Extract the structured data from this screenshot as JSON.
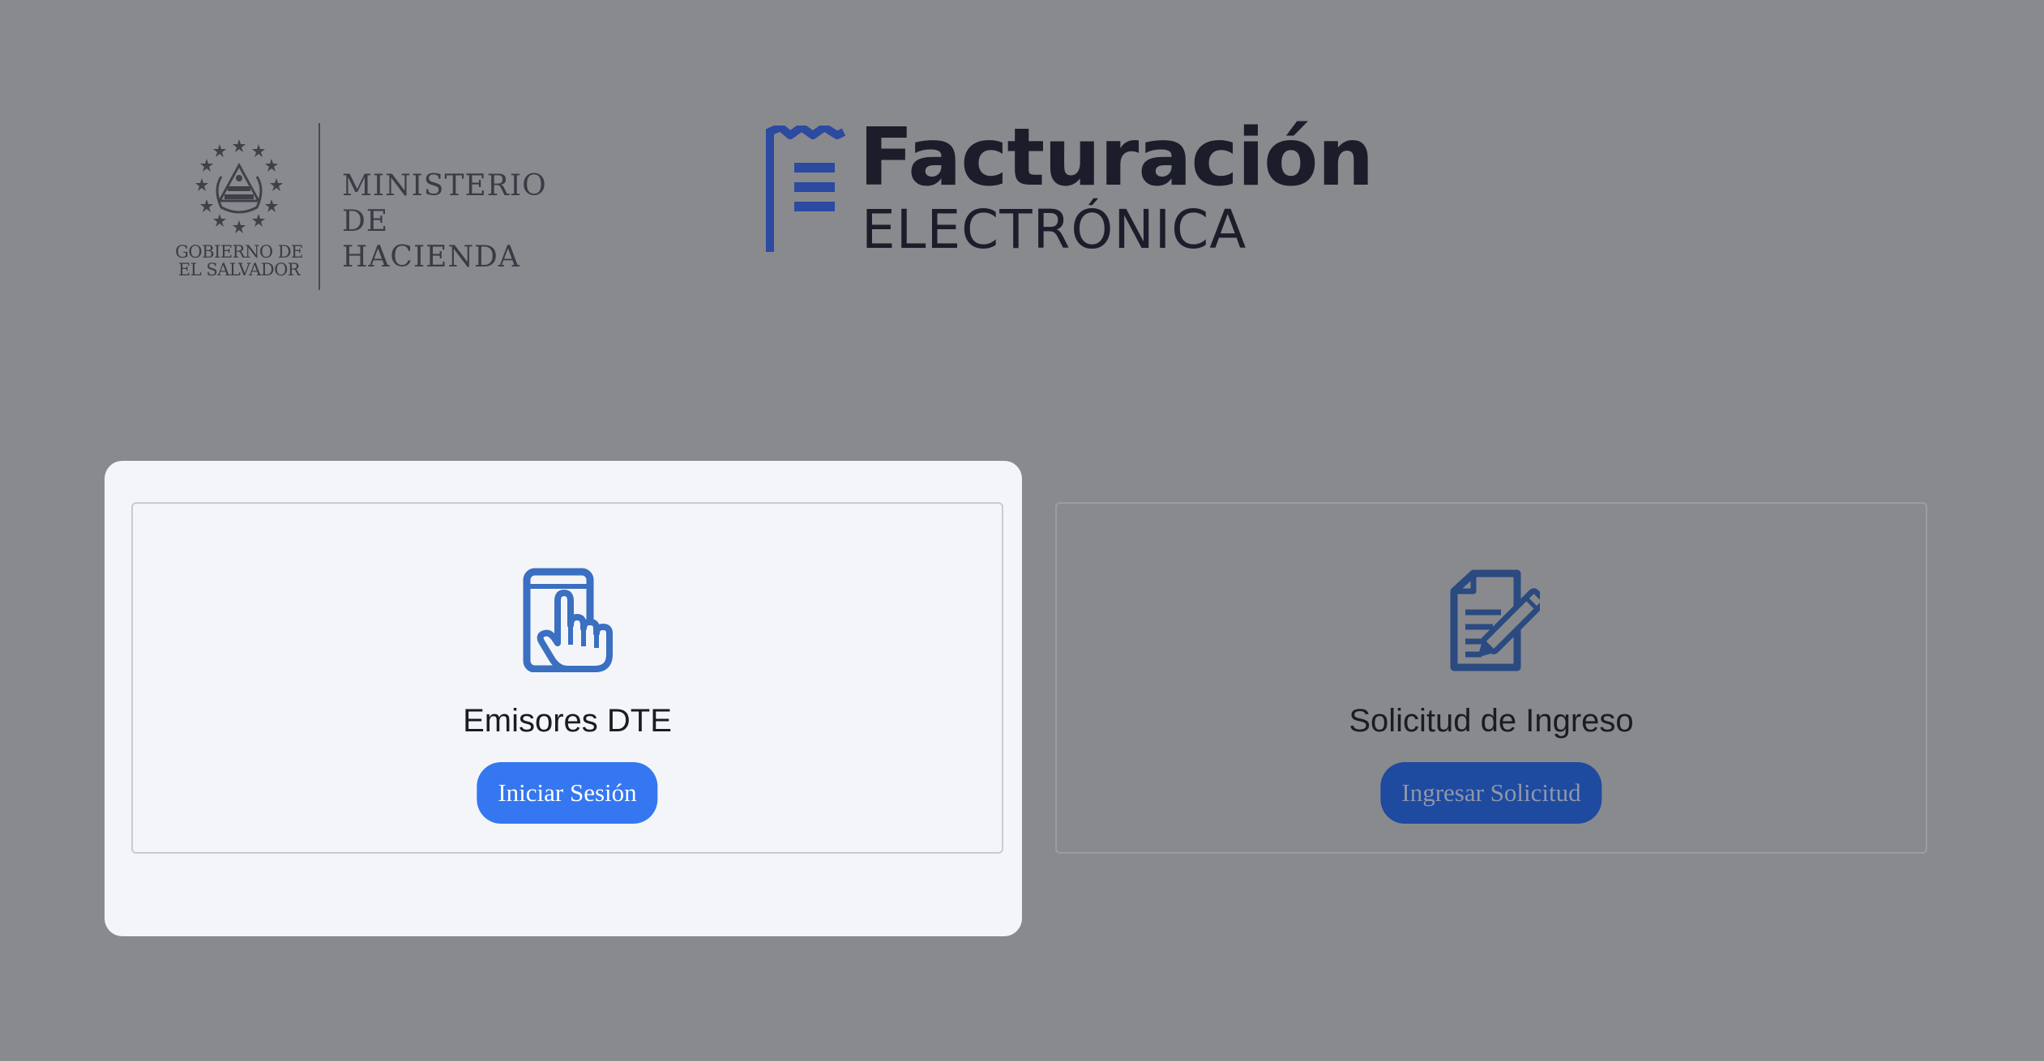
{
  "header": {
    "government": {
      "emblem_caption_line1": "GOBIERNO DE",
      "emblem_caption_line2": "EL SALVADOR",
      "ministry_line1": "MINISTERIO",
      "ministry_line2": "DE HACIENDA"
    },
    "product": {
      "title": "Facturación",
      "subtitle": "ELECTRÓNICA"
    }
  },
  "cards": {
    "emisores": {
      "icon": "tap-phone-icon",
      "title": "Emisores DTE",
      "button_label": "Iniciar Sesión"
    },
    "solicitud": {
      "icon": "document-edit-icon",
      "title": "Solicitud de Ingreso",
      "button_label": "Ingresar Solicitud"
    }
  },
  "colors": {
    "overlay_background": "#898a8e",
    "panel_background": "#f4f5f9",
    "primary_button": "#3477f0",
    "dimmed_button": "#1e4aa0",
    "brand_blue": "#2b4aa0",
    "icon_blue": "#3a6fc1",
    "icon_dim": "#2a4a80"
  }
}
